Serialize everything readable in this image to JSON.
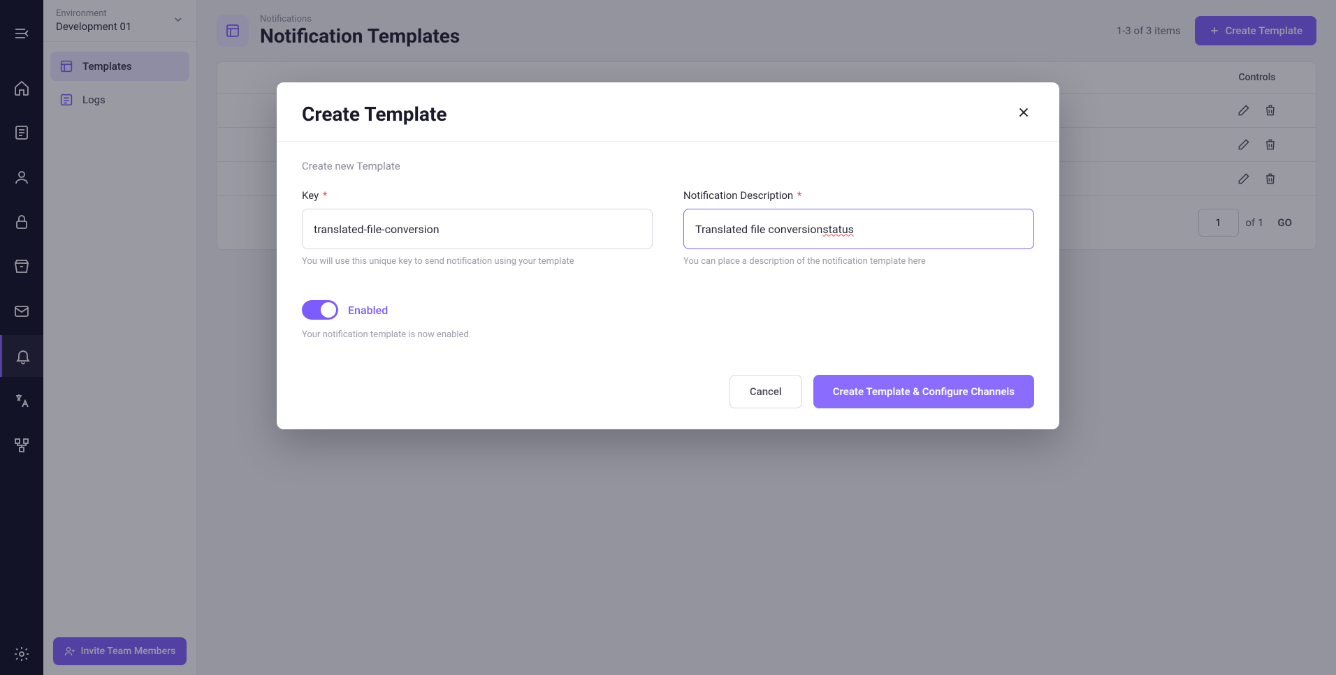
{
  "env": {
    "label": "Environment",
    "value": "Development 01"
  },
  "sidebar": {
    "items": [
      {
        "label": "Templates"
      },
      {
        "label": "Logs"
      }
    ],
    "invite_label": "Invite Team Members"
  },
  "header": {
    "breadcrumb": "Notifications",
    "title": "Notification Templates",
    "items_range": "1-3 of 3 items",
    "create_label": "Create Template"
  },
  "table": {
    "controls_header": "Controls",
    "row_count": 3
  },
  "pagination": {
    "current_page": "1",
    "of_label": "of 1",
    "go_label": "GO"
  },
  "modal": {
    "title": "Create Template",
    "subtitle": "Create new Template",
    "fields": {
      "key": {
        "label": "Key",
        "value": "translated-file-conversion",
        "help": "You will use this unique key to send notification using your template"
      },
      "description": {
        "label": "Notification Description",
        "value_prefix": "Translated file conversion ",
        "value_underlined": "status",
        "help": "You can place a description of the notification template here"
      }
    },
    "toggle": {
      "label": "Enabled",
      "help": "Your notification template is now enabled"
    },
    "footer": {
      "cancel": "Cancel",
      "submit": "Create Template & Configure Channels"
    }
  },
  "required_marker": "*"
}
